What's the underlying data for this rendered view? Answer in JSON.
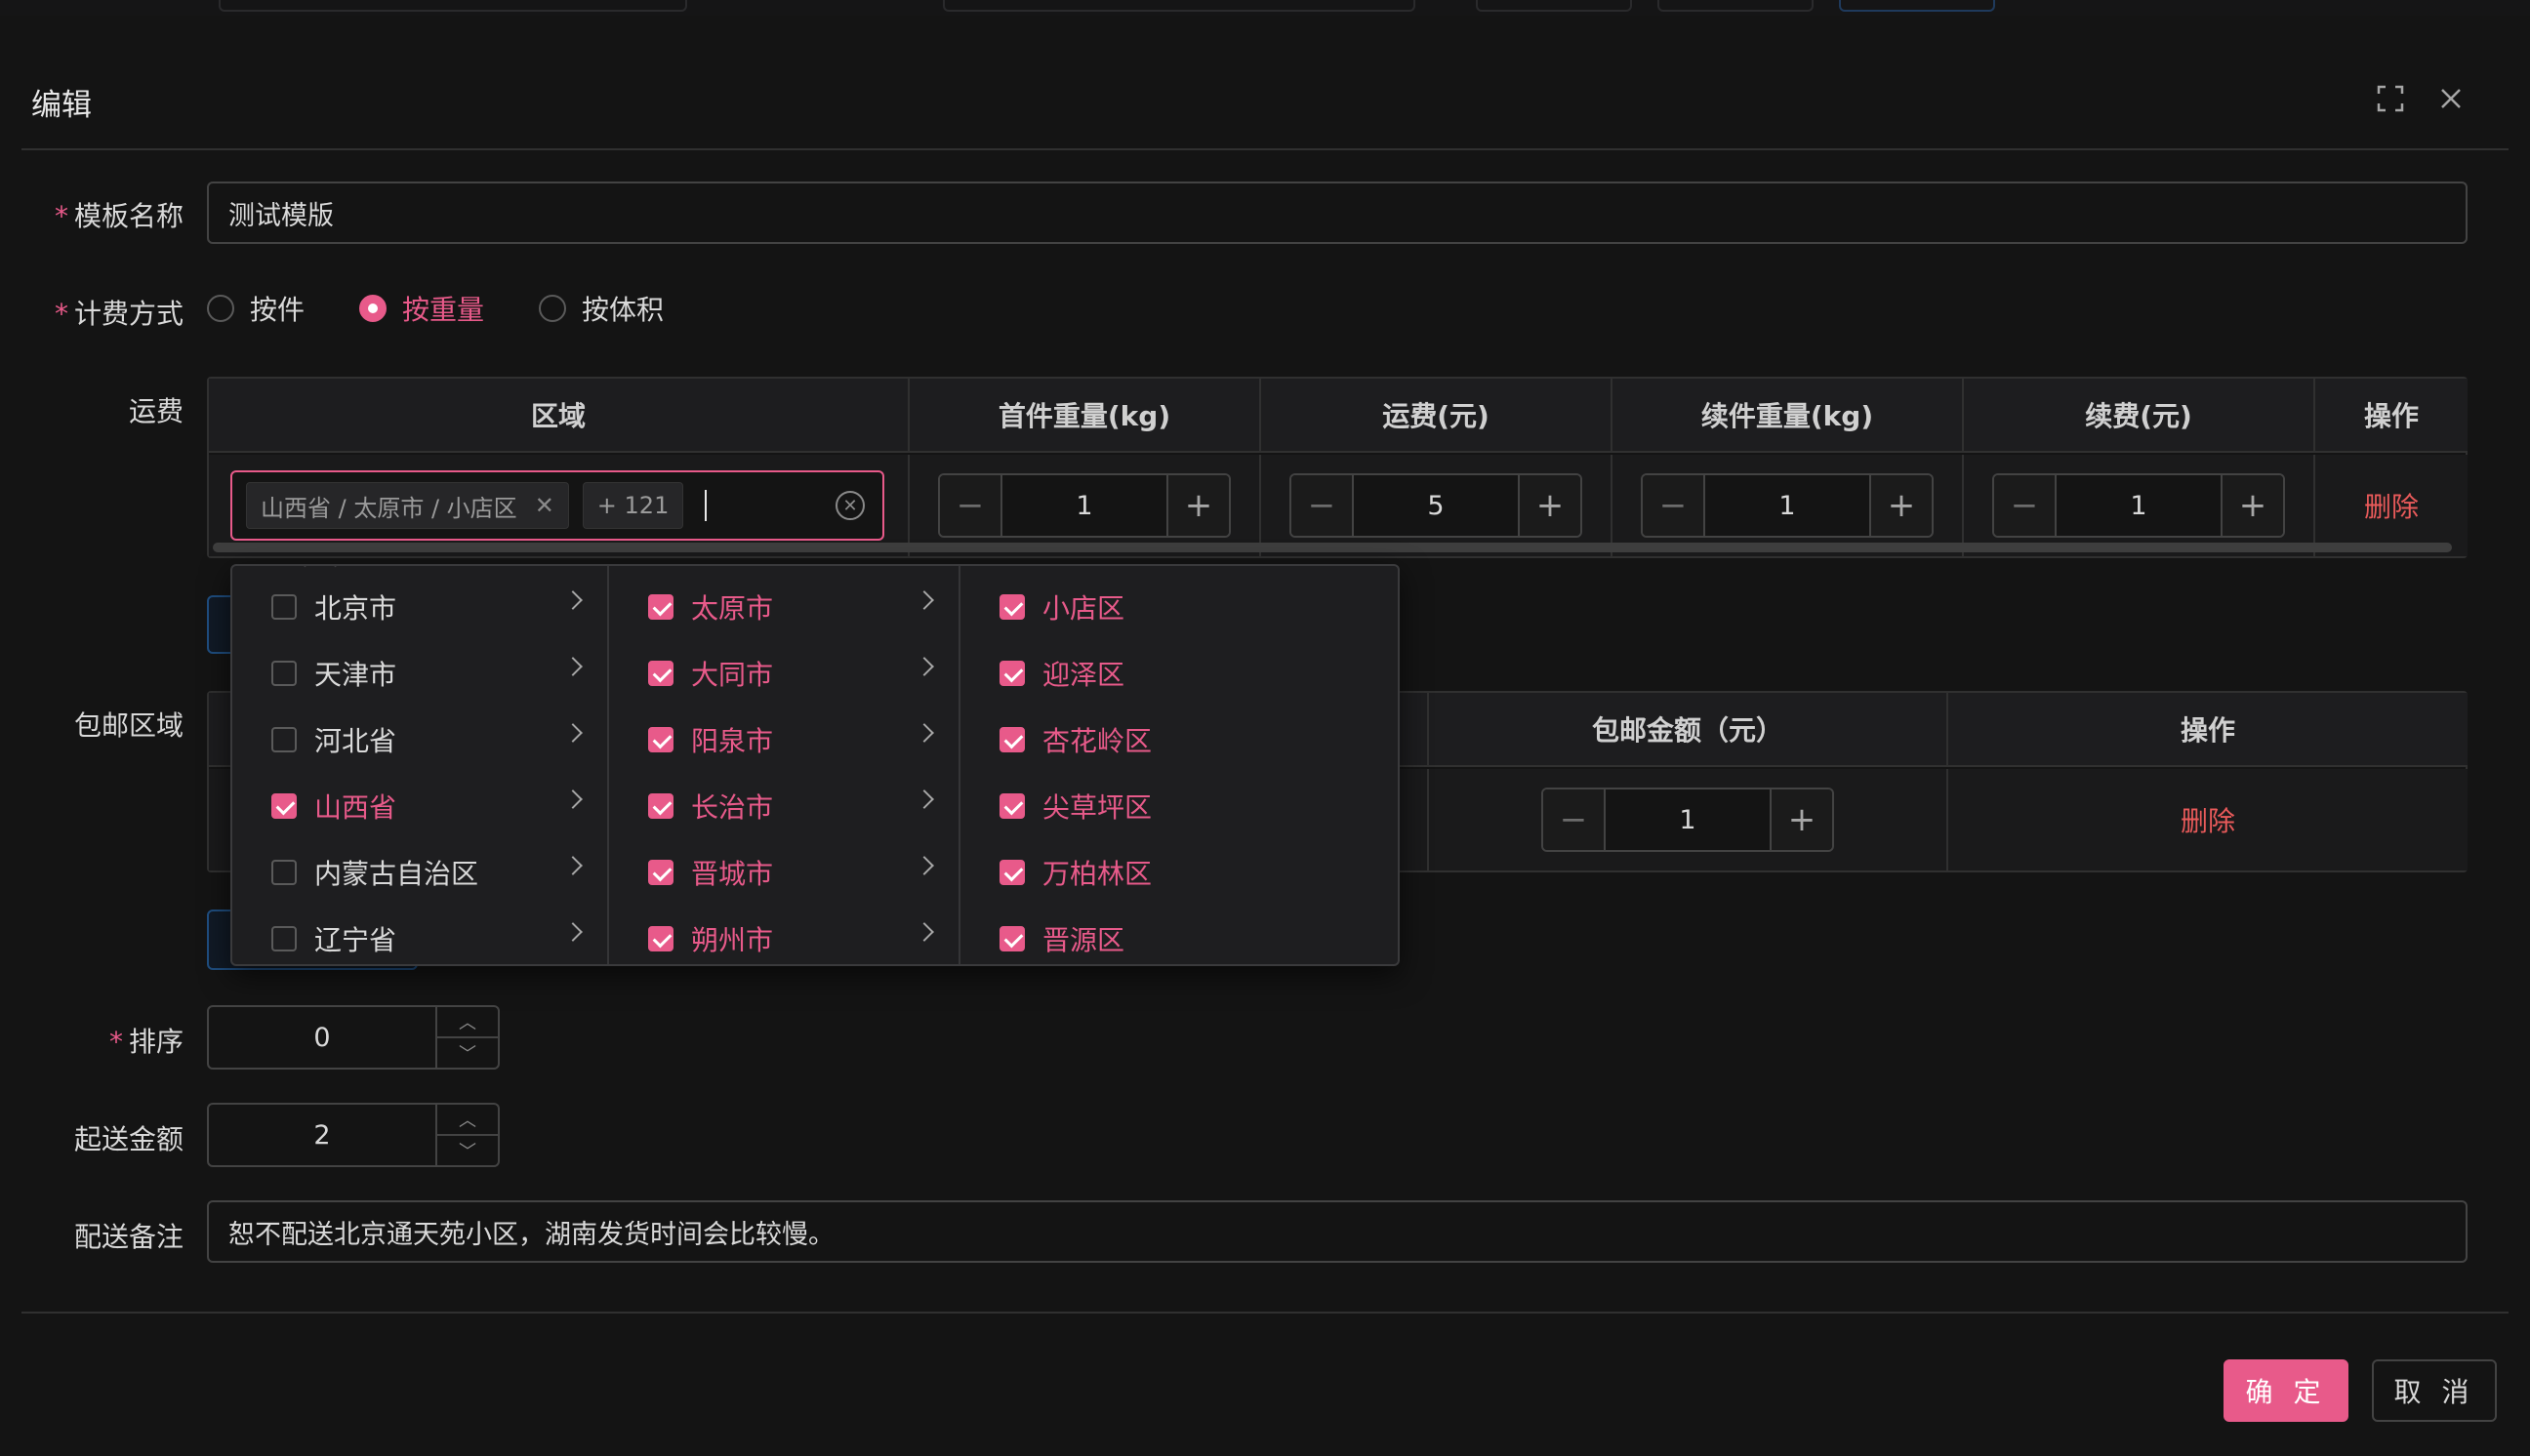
{
  "dialog": {
    "title": "编辑",
    "fullscreen_icon": "fullscreen-icon",
    "close_icon": "close-icon"
  },
  "form": {
    "template_name": {
      "label": "模板名称",
      "value": "测试模版"
    },
    "billing": {
      "label": "计费方式",
      "options": [
        {
          "label": "按件",
          "checked": false
        },
        {
          "label": "按重量",
          "checked": true
        },
        {
          "label": "按体积",
          "checked": false
        }
      ]
    },
    "freight": {
      "label": "运费",
      "headers": [
        "区域",
        "首件重量(kg)",
        "运费(元)",
        "续件重量(kg)",
        "续费(元)",
        "操作"
      ],
      "row": {
        "region_tag": "山西省 / 太原市 / 小店区",
        "more_tag": "+ 121",
        "first_weight": "1",
        "fee": "5",
        "extra_weight": "1",
        "extra_fee": "1",
        "action": "删除"
      }
    },
    "free_shipping": {
      "label": "包邮区域",
      "headers": [
        "包邮金额（元）",
        "操作"
      ],
      "row": {
        "amount": "1",
        "action": "删除"
      }
    },
    "sort": {
      "label": "排序",
      "value": "0"
    },
    "min_amount": {
      "label": "起送金额",
      "value": "2"
    },
    "note": {
      "label": "配送备注",
      "value": "恕不配送北京通天苑小区，湖南发货时间会比较慢。"
    }
  },
  "cascader": {
    "provinces": [
      {
        "label": "北京市",
        "checked": false
      },
      {
        "label": "天津市",
        "checked": false
      },
      {
        "label": "河北省",
        "checked": false
      },
      {
        "label": "山西省",
        "checked": true
      },
      {
        "label": "内蒙古自治区",
        "checked": false
      },
      {
        "label": "辽宁省",
        "checked": false
      }
    ],
    "cities": [
      {
        "label": "太原市",
        "checked": true
      },
      {
        "label": "大同市",
        "checked": true
      },
      {
        "label": "阳泉市",
        "checked": true
      },
      {
        "label": "长治市",
        "checked": true
      },
      {
        "label": "晋城市",
        "checked": true
      },
      {
        "label": "朔州市",
        "checked": true
      }
    ],
    "districts": [
      {
        "label": "小店区",
        "checked": true
      },
      {
        "label": "迎泽区",
        "checked": true
      },
      {
        "label": "杏花岭区",
        "checked": true
      },
      {
        "label": "尖草坪区",
        "checked": true
      },
      {
        "label": "万柏林区",
        "checked": true
      },
      {
        "label": "晋源区",
        "checked": true
      }
    ]
  },
  "footer": {
    "ok": "确 定",
    "cancel": "取 消"
  },
  "colors": {
    "accent": "#e85a8a",
    "danger": "#e85a5a",
    "background": "#141414"
  }
}
